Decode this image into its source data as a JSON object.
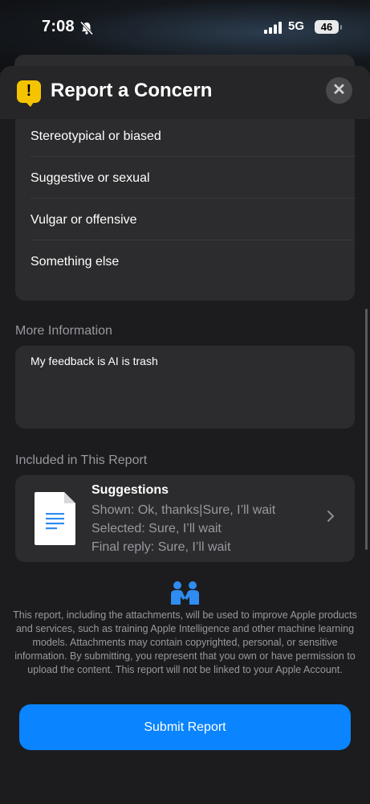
{
  "status_bar": {
    "time": "7:08",
    "network": "5G",
    "battery": "46"
  },
  "sheet": {
    "title": "Report a Concern",
    "close_label": "✕"
  },
  "concern_options": [
    "Stereotypical or biased",
    "Suggestive or sexual",
    "Vulgar or offensive",
    "Something else"
  ],
  "more_information": {
    "label": "More Information",
    "value": "My feedback is AI is trash"
  },
  "included": {
    "label": "Included in This Report",
    "title": "Suggestions",
    "shown": "Shown: Ok, thanks|Sure, I’ll wait",
    "selected": "Selected: Sure, I’ll wait",
    "final_reply": "Final reply: Sure, I’ll wait"
  },
  "disclaimer": "This report, including the attachments, will be used to improve Apple products and services, such as training Apple Intelligence and other machine learning models. Attachments may contain copyrighted, personal, or sensitive information. By submitting, you represent that you own or have permission to upload the content. This report will not be linked to your Apple Account.",
  "submit_label": "Submit Report",
  "colors": {
    "accent": "#0a84ff",
    "warning": "#f5c400",
    "background": "#1c1c1e",
    "card": "#2c2c2e"
  }
}
